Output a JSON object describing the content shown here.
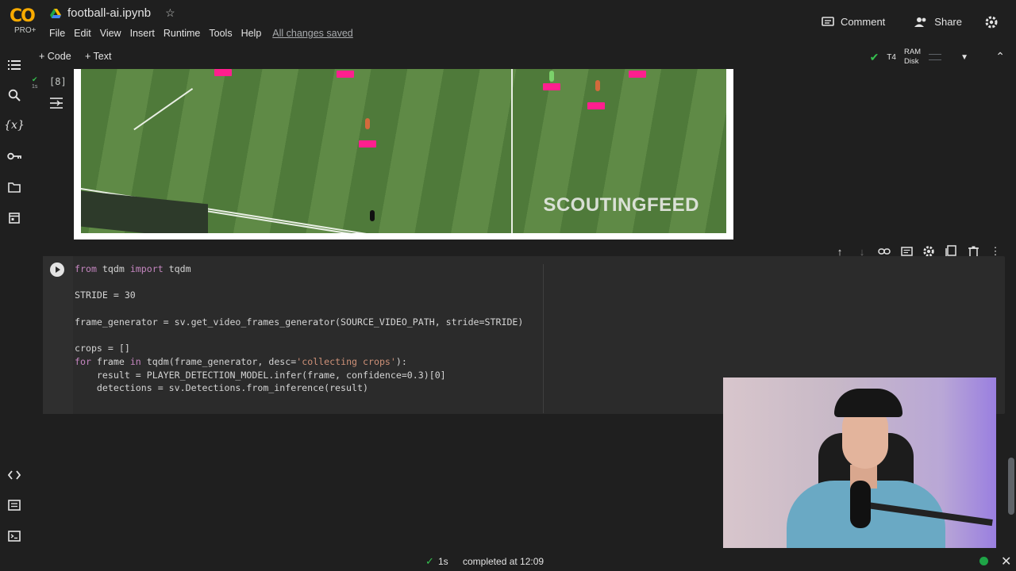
{
  "app": {
    "logo_text": "CO",
    "logo_badge": "PRO+",
    "notebook_title": "football-ai.ipynb",
    "star_icon": "star-icon"
  },
  "menu": {
    "items": [
      "File",
      "Edit",
      "View",
      "Insert",
      "Runtime",
      "Tools",
      "Help"
    ],
    "save_status": "All changes saved"
  },
  "header_actions": {
    "comment_label": "Comment",
    "share_label": "Share",
    "settings_icon": "gear-icon"
  },
  "toolbar": {
    "add_code_label": "+ Code",
    "add_text_label": "+ Text",
    "runtime_type": "T4",
    "ram_label": "RAM",
    "disk_label": "Disk"
  },
  "sidebar": {
    "icons": [
      "table-of-contents-icon",
      "search-icon",
      "variables-icon",
      "secrets-key-icon",
      "files-folder-icon",
      "calendar-icon",
      "code-snippets-icon",
      "command-palette-icon",
      "terminal-icon"
    ],
    "variables_glyph": "{x}"
  },
  "output_cell": {
    "execution_count": "[8]",
    "exec_time": "1s",
    "watermark": "SCOUTINGFEED"
  },
  "code_cell": {
    "lines": [
      {
        "parts": [
          {
            "t": "from",
            "c": "kw"
          },
          {
            "t": " tqdm "
          },
          {
            "t": "import",
            "c": "kw"
          },
          {
            "t": " tqdm"
          }
        ]
      },
      {
        "parts": []
      },
      {
        "parts": [
          {
            "t": "STRIDE = 30"
          }
        ]
      },
      {
        "parts": []
      },
      {
        "parts": [
          {
            "t": "frame_generator = sv.get_video_frames_generator(SOURCE_VIDEO_PATH, stride=STRIDE)"
          }
        ]
      },
      {
        "parts": []
      },
      {
        "parts": [
          {
            "t": "crops = []"
          }
        ]
      },
      {
        "parts": [
          {
            "t": "for",
            "c": "kw"
          },
          {
            "t": " frame "
          },
          {
            "t": "in",
            "c": "kw"
          },
          {
            "t": " tqdm(frame_generator, desc="
          },
          {
            "t": "'collecting crops'",
            "c": "str"
          },
          {
            "t": "):"
          }
        ]
      },
      {
        "parts": [
          {
            "t": "    result = PLAYER_DETECTION_MODEL.infer(frame, confidence=0.3)[0]"
          }
        ]
      },
      {
        "parts": [
          {
            "t": "    detections = sv.Detections.from_inference(result)"
          }
        ]
      }
    ],
    "cell_tool_icons": [
      "move-up-icon",
      "move-down-icon",
      "link-icon",
      "comment-icon",
      "cell-settings-icon",
      "mirror-cell-icon",
      "delete-icon",
      "more-options-icon"
    ]
  },
  "status_bar": {
    "duration": "1s",
    "message": "completed at 12:09",
    "colors": {
      "ok": "#1ea446"
    }
  }
}
